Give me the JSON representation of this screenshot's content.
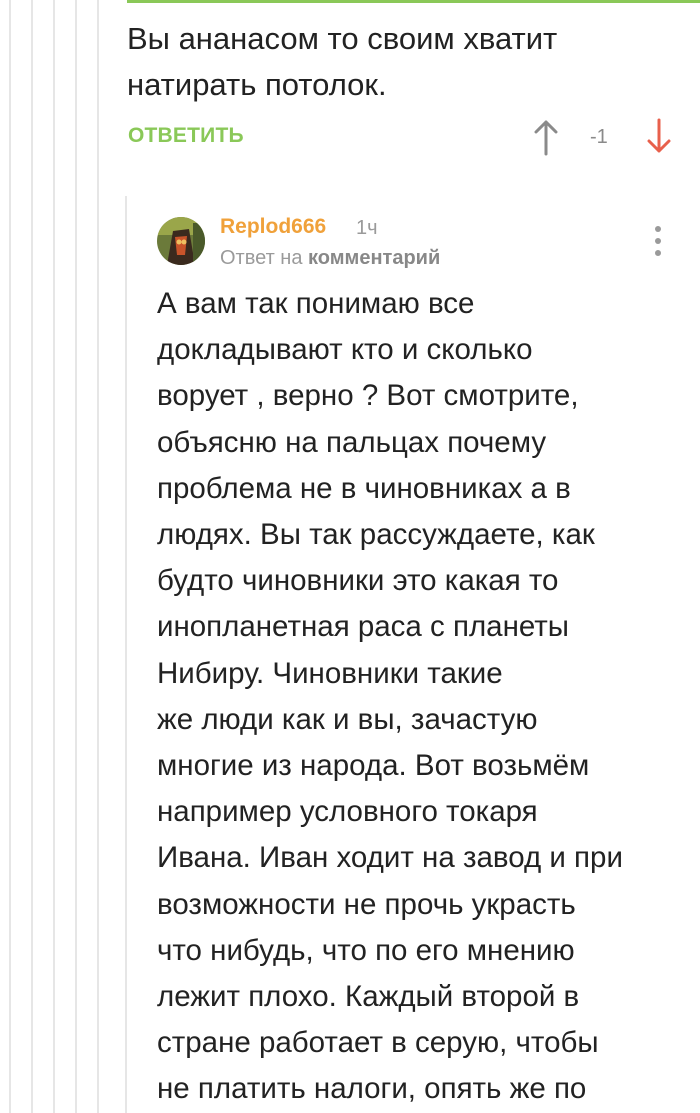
{
  "parent_comment": {
    "lines": [
      "Вы ананасом то своим хватит",
      "натирать потолок."
    ],
    "reply_label": "ОТВЕТИТЬ",
    "rating": "-1"
  },
  "reply_comment": {
    "author": "Replod666",
    "time": "1ч",
    "reply_to_prefix": "Ответ на",
    "reply_to_link": "комментарий",
    "body_lines": [
      "А вам так понимаю все",
      "докладывают кто и сколько",
      "ворует , верно ? Вот смотрите,",
      "объясню на пальцах почему",
      "проблема не в чиновниках а в",
      "людях. Вы так рассуждаете, как",
      "будто чиновники это какая то",
      "инопланетная раса с планеты",
      "Нибиру. Чиновники такие",
      "же люди как и вы, зачастую",
      "многие из народа. Вот возьмём",
      "например условного токаря",
      "Ивана. Иван ходит на завод и при",
      "возможности не прочь украсть",
      "что нибудь, что по его мнению",
      "лежит плохо. Каждый второй в",
      "стране работает в серую, чтобы",
      "не платить налоги, опять же по"
    ]
  },
  "colors": {
    "accent_green": "#8ac858",
    "author_orange": "#f0a13a",
    "downvote_red": "#e8604c",
    "muted_gray": "#9a9a9a",
    "thread_line": "#e6e6e6"
  },
  "icons": {
    "upvote": "arrow-up-icon",
    "downvote": "arrow-down-icon",
    "menu": "more-vertical-icon"
  }
}
